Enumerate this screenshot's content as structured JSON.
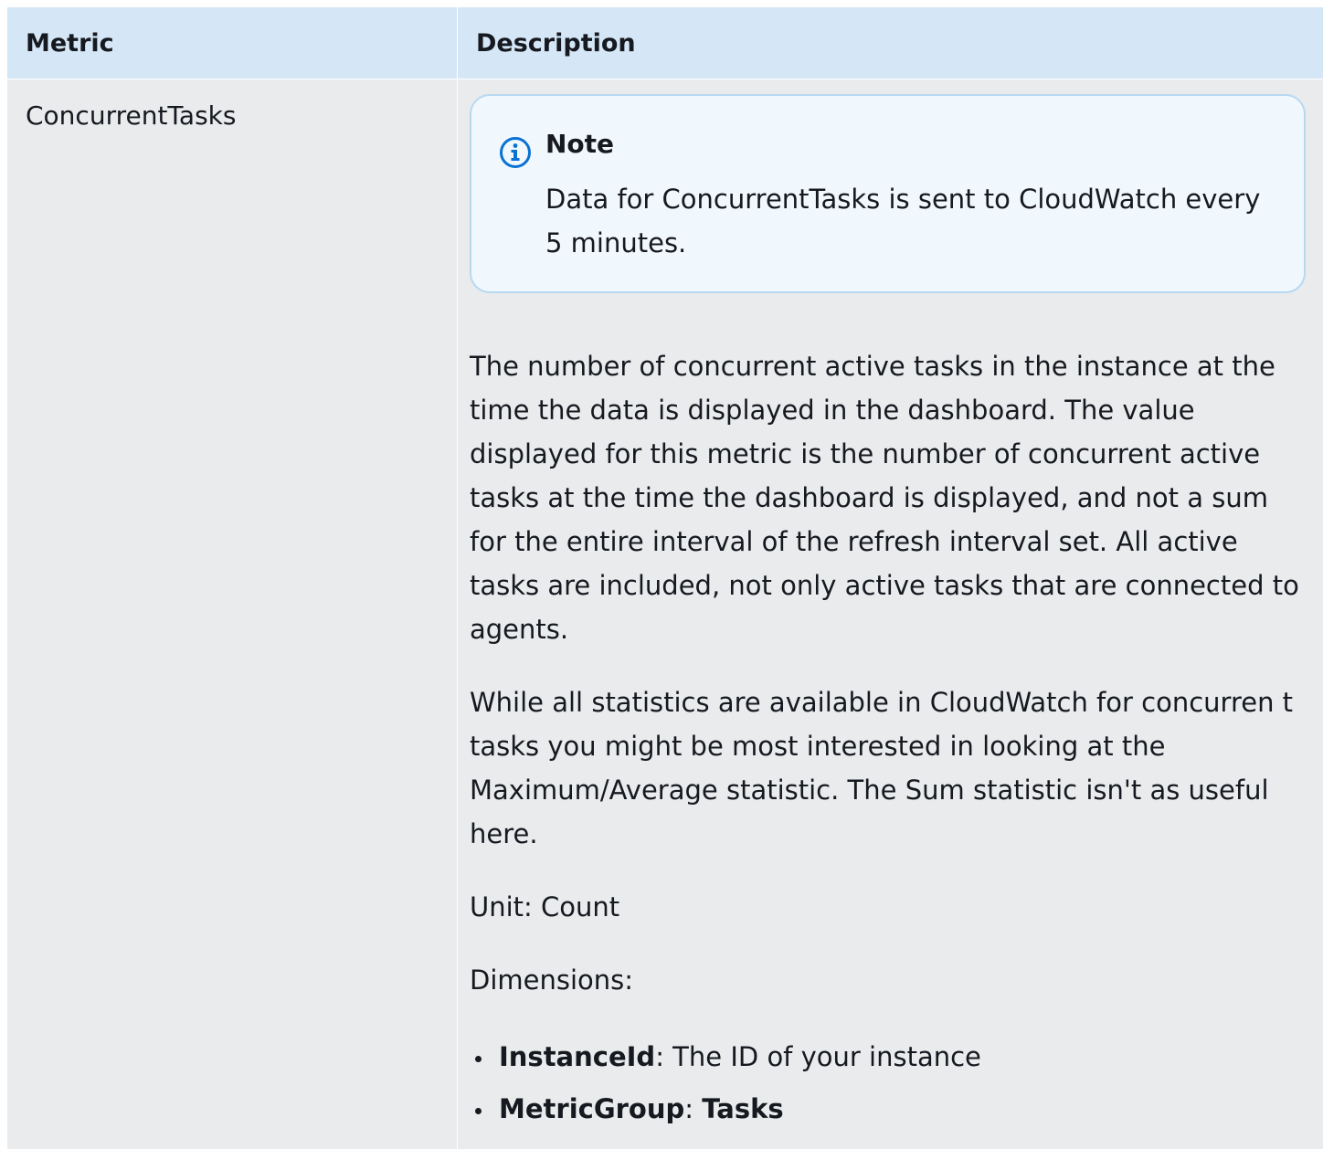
{
  "table": {
    "headers": {
      "metric": "Metric",
      "description": "Description"
    },
    "row": {
      "metric_name": "ConcurrentTasks",
      "note": {
        "title": "Note",
        "icon": "info-icon",
        "body": "Data for ConcurrentTasks is sent to CloudWatch every 5 minutes."
      },
      "paragraphs": [
        "The number of concurrent active tasks in the instance at the time the data is displayed in the dashboard. The value displayed for this metric is the number of concurrent active tasks at the time the dashboard is displayed, and not a sum for the entire interval of the refresh interval set. All active tasks are included, not only active tasks that are connected to agents.",
        "While all statistics are available in CloudWatch for concurren t tasks you might be most interested in looking at the Maximum/Average statistic. The Sum statistic isn't as useful here.",
        "Unit: Count",
        "Dimensions:"
      ],
      "dimensions": [
        {
          "name": "InstanceId",
          "separator": ":",
          "value": " The ID of your instance"
        },
        {
          "name": "MetricGroup",
          "separator": ": ",
          "value": "Tasks"
        }
      ]
    }
  },
  "colors": {
    "header_bg": "#d5e7f7",
    "row_bg": "#e9ebed",
    "note_bg": "#f1f8fd",
    "note_border": "#b7d8f1",
    "info_icon": "#0972d3"
  }
}
